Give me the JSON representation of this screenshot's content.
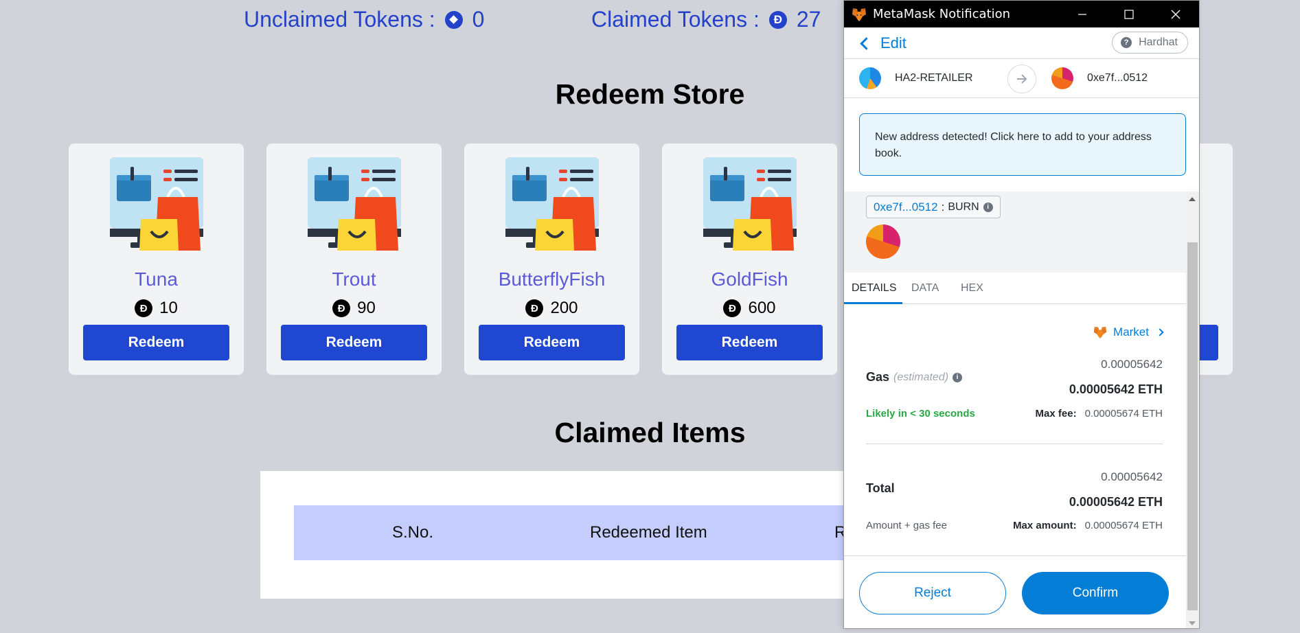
{
  "dapp": {
    "unclaimed_label": "Unclaimed Tokens :",
    "unclaimed_value": "0",
    "claimed_label": "Claimed Tokens :",
    "claimed_value": "27",
    "token_symbol": "Đ",
    "store_title": "Redeem Store",
    "items": [
      {
        "name": "Tuna",
        "price": "10",
        "button": "Redeem"
      },
      {
        "name": "Trout",
        "price": "90",
        "button": "Redeem"
      },
      {
        "name": "ButterflyFish",
        "price": "200",
        "button": "Redeem"
      },
      {
        "name": "GoldFish",
        "price": "600",
        "button": "Redeem"
      }
    ],
    "claimed_title": "Claimed Items",
    "table_headers": [
      "S.No.",
      "Redeemed Item",
      "R"
    ]
  },
  "metamask": {
    "window_title": "MetaMask Notification",
    "edit_label": "Edit",
    "network": "Hardhat",
    "network_icon": "?",
    "from_account": "HA2-RETAILER",
    "to_account": "0xe7f...0512",
    "notice": "New address detected! Click here to add to your address book.",
    "method_address": "0xe7f...0512",
    "method_sep": ":",
    "method_name": "BURN",
    "tabs": [
      "DETAILS",
      "DATA",
      "HEX"
    ],
    "market_label": "Market",
    "gas_label": "Gas",
    "gas_estimated": "(estimated)",
    "gas_value": "0.00005642",
    "gas_value_eth": "0.00005642 ETH",
    "likely_text": "Likely in < 30 seconds",
    "max_fee_label": "Max fee:",
    "max_fee_value": "0.00005674 ETH",
    "total_label": "Total",
    "total_value": "0.00005642",
    "total_value_eth": "0.00005642 ETH",
    "amount_gas_label": "Amount + gas fee",
    "max_amount_label": "Max amount:",
    "max_amount_value": "0.00005674 ETH",
    "reject_label": "Reject",
    "confirm_label": "Confirm"
  },
  "colors": {
    "accent_blue": "#2442c9",
    "metamask_blue": "#037dd6",
    "likely_green": "#28a745"
  }
}
